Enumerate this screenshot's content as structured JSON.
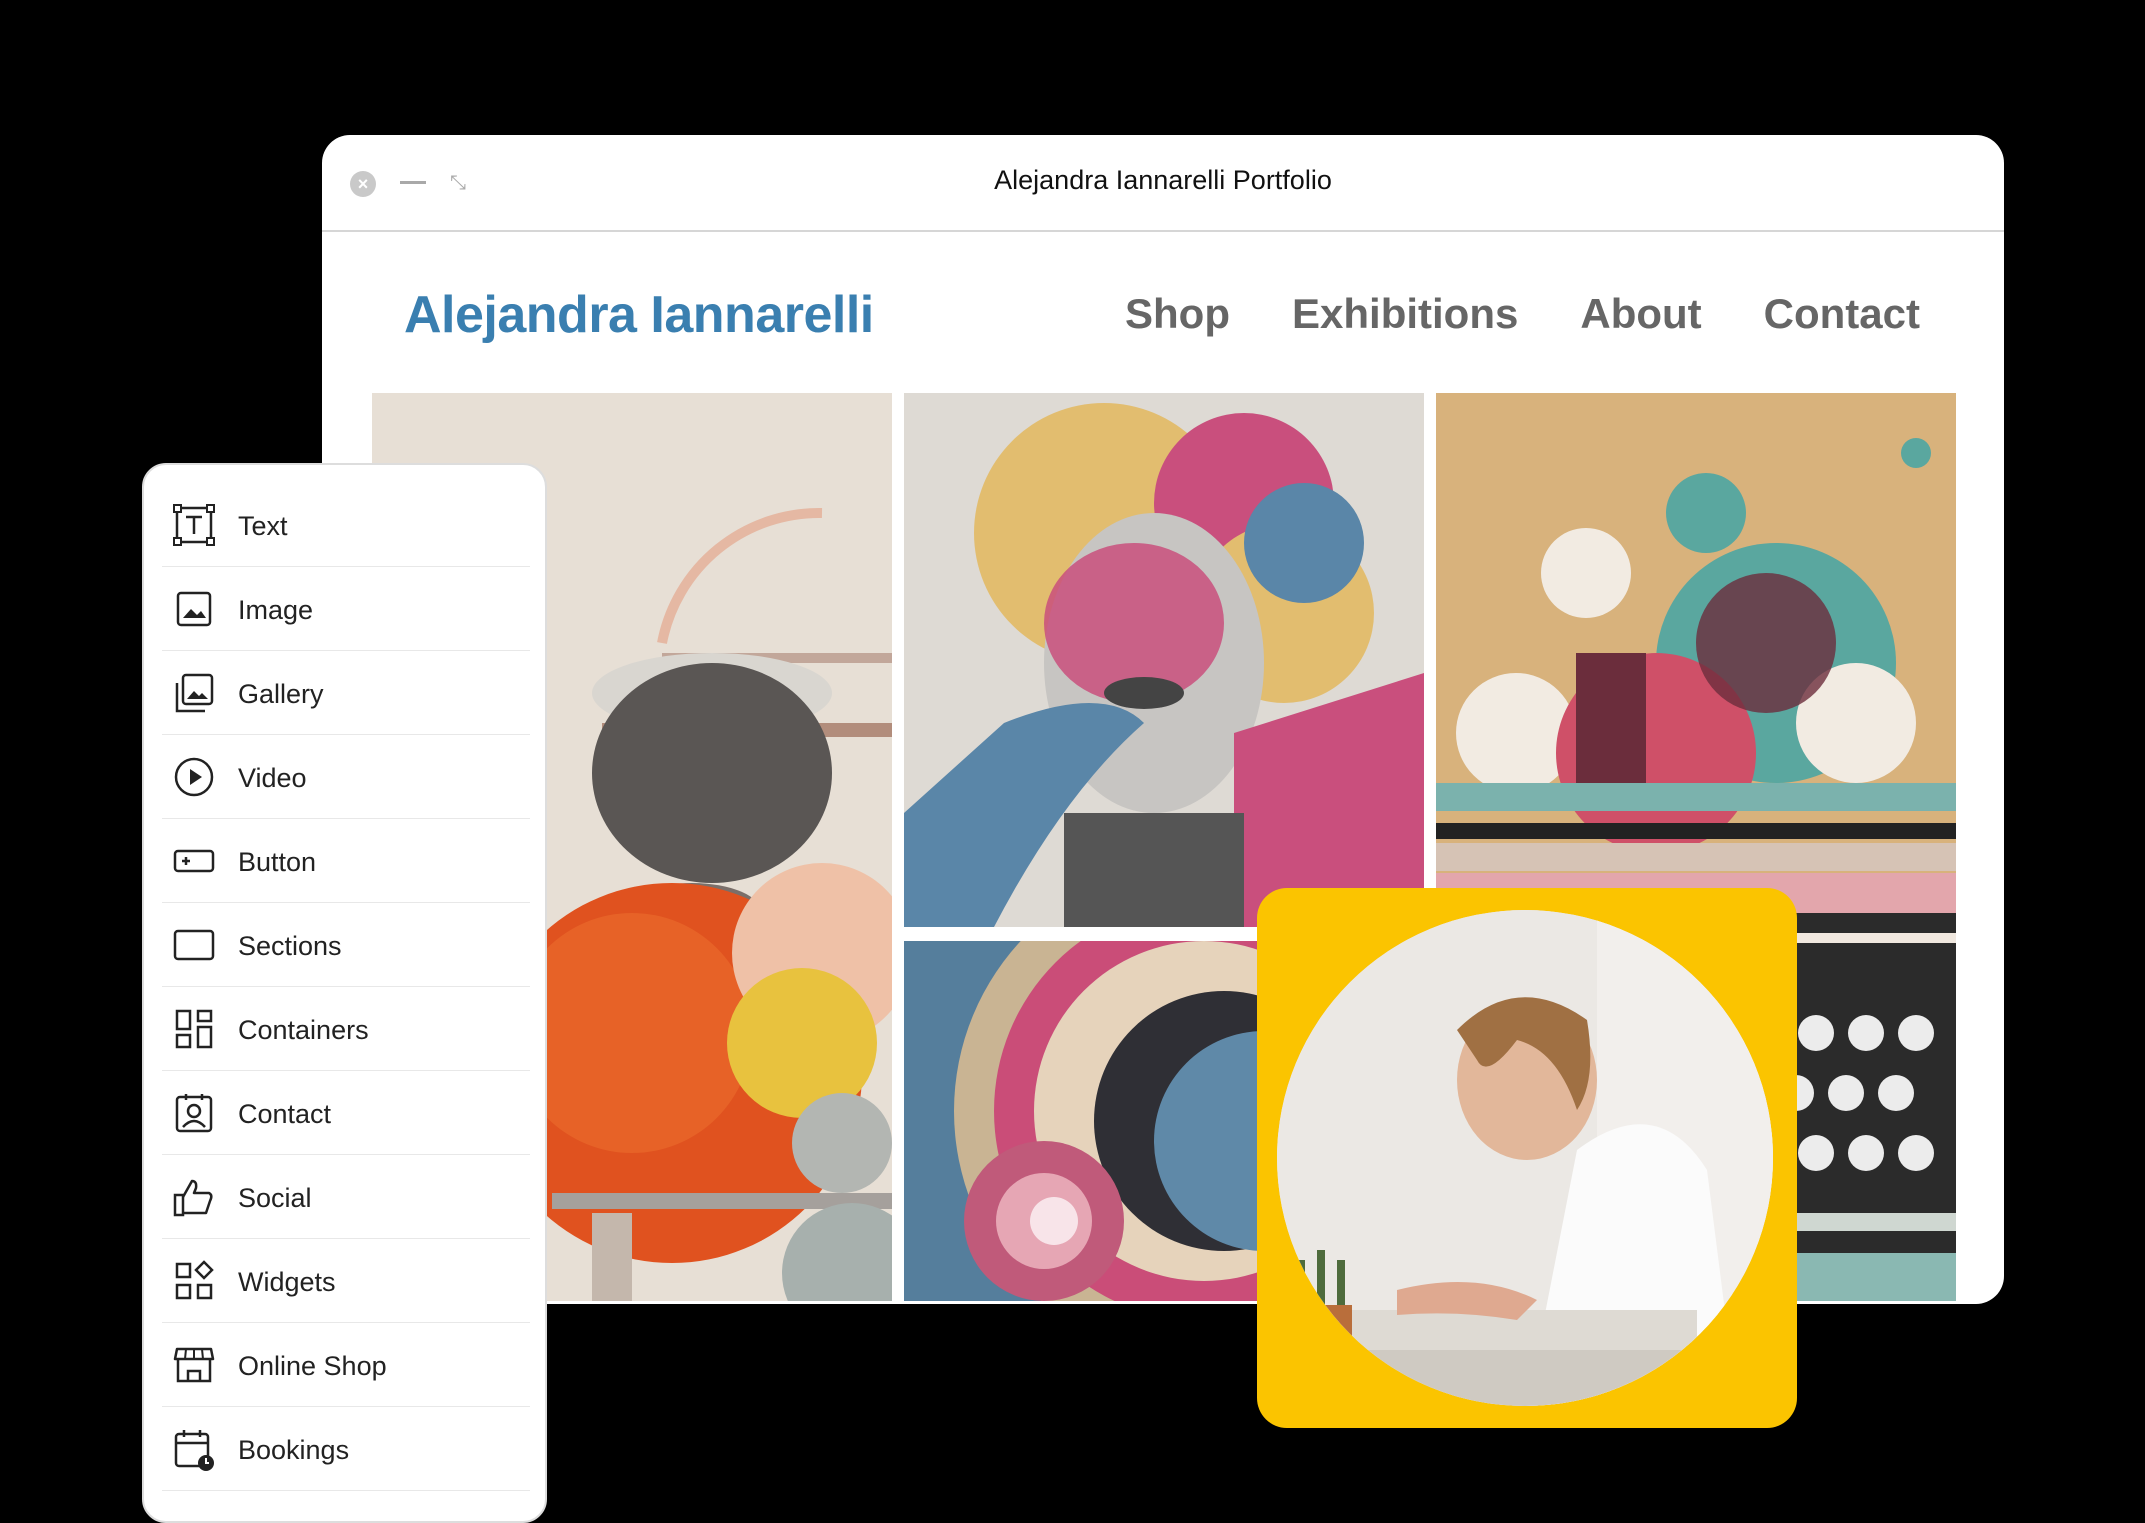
{
  "window": {
    "title": "Alejandra Iannarelli Portfolio"
  },
  "site": {
    "name": "Alejandra Iannarelli",
    "nav": [
      "Shop",
      "Exhibitions",
      "About",
      "Contact"
    ]
  },
  "panel": {
    "items": [
      {
        "label": "Text",
        "icon": "text-icon"
      },
      {
        "label": "Image",
        "icon": "image-icon"
      },
      {
        "label": "Gallery",
        "icon": "gallery-icon"
      },
      {
        "label": "Video",
        "icon": "video-icon"
      },
      {
        "label": "Button",
        "icon": "button-icon"
      },
      {
        "label": "Sections",
        "icon": "sections-icon"
      },
      {
        "label": "Containers",
        "icon": "containers-icon"
      },
      {
        "label": "Contact",
        "icon": "contact-icon"
      },
      {
        "label": "Social",
        "icon": "thumbs-up-icon"
      },
      {
        "label": "Widgets",
        "icon": "widgets-icon"
      },
      {
        "label": "Online Shop",
        "icon": "shop-icon"
      },
      {
        "label": "Bookings",
        "icon": "calendar-icon"
      }
    ]
  },
  "colors": {
    "brand": "#3a7fb0",
    "accent": "#fbc400"
  }
}
